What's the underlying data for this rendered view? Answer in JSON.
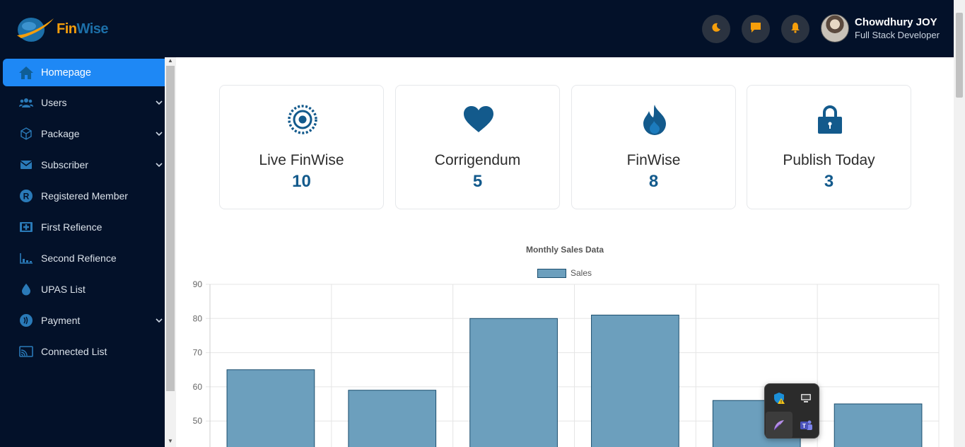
{
  "brand": {
    "name_part1": "Fin",
    "name_part2": "Wise",
    "accent": "#f59e0b",
    "brand_blue": "#1c6fa8"
  },
  "header": {
    "icons": [
      "moon-icon",
      "chat-icon",
      "bell-icon"
    ],
    "user": {
      "name": "Chowdhury JOY",
      "role": "Full Stack Developer"
    }
  },
  "sidebar": {
    "items": [
      {
        "label": "Homepage",
        "icon": "home-icon",
        "active": true,
        "has_submenu": false
      },
      {
        "label": "Users",
        "icon": "users-icon",
        "active": false,
        "has_submenu": true
      },
      {
        "label": "Package",
        "icon": "package-icon",
        "active": false,
        "has_submenu": true
      },
      {
        "label": "Subscriber",
        "icon": "mail-icon",
        "active": false,
        "has_submenu": true
      },
      {
        "label": "Registered Member",
        "icon": "registered-icon",
        "active": false,
        "has_submenu": false
      },
      {
        "label": "First Refience",
        "icon": "first-aid-icon",
        "active": false,
        "has_submenu": false
      },
      {
        "label": "Second Refience",
        "icon": "chart-icon",
        "active": false,
        "has_submenu": false
      },
      {
        "label": "UPAS List",
        "icon": "droplet-icon",
        "active": false,
        "has_submenu": false
      },
      {
        "label": "Payment",
        "icon": "coin-icon",
        "active": false,
        "has_submenu": true
      },
      {
        "label": "Connected List",
        "icon": "cast-icon",
        "active": false,
        "has_submenu": false
      }
    ]
  },
  "cards": [
    {
      "title": "Live FinWise",
      "value": "10",
      "icon": "target-icon"
    },
    {
      "title": "Corrigendum",
      "value": "5",
      "icon": "heart-icon"
    },
    {
      "title": "FinWise",
      "value": "8",
      "icon": "fire-icon"
    },
    {
      "title": "Publish Today",
      "value": "3",
      "icon": "lock-icon"
    }
  ],
  "chart_data": {
    "type": "bar",
    "title": "Monthly Sales Data",
    "series": [
      {
        "name": "Sales",
        "values": [
          65,
          59,
          80,
          81,
          56,
          55
        ]
      }
    ],
    "y_ticks": [
      90,
      80,
      70,
      60,
      50
    ],
    "ylim_visible": [
      50,
      90
    ],
    "colors": {
      "fill": "#6c9fbd",
      "stroke": "#1b4e6e"
    },
    "grid": true,
    "legend": "top"
  },
  "tray": {
    "icons": [
      "defender-warning-icon",
      "monitor-icon",
      "feather-icon",
      "teams-icon"
    ]
  }
}
